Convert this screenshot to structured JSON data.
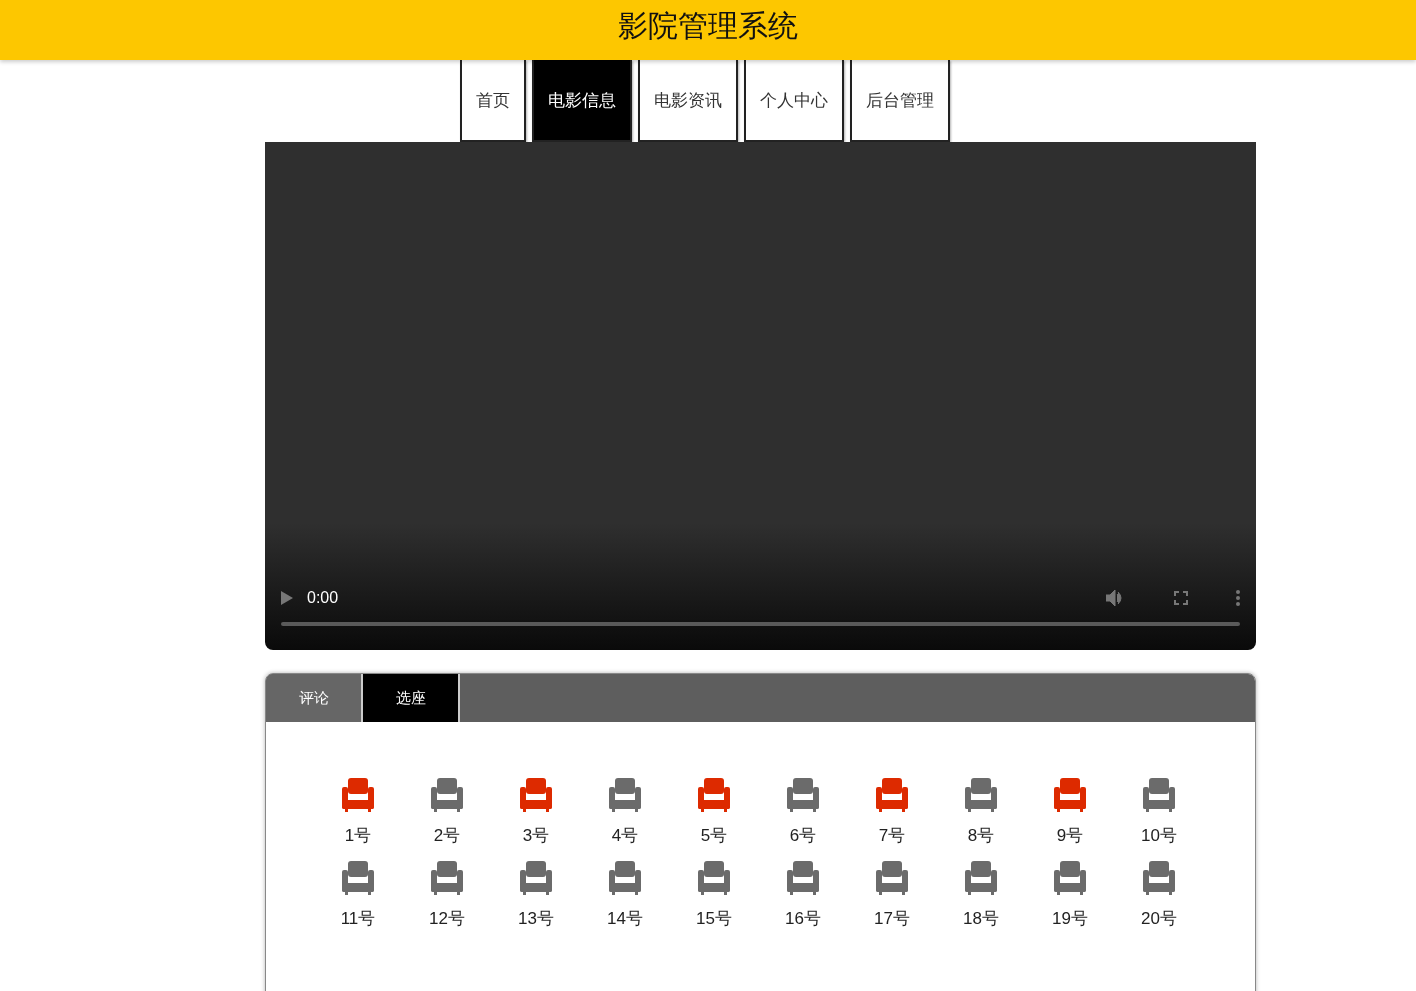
{
  "header": {
    "title": "影院管理系统"
  },
  "nav": [
    {
      "label": "首页",
      "selected": false
    },
    {
      "label": "电影信息",
      "selected": true
    },
    {
      "label": "电影资讯",
      "selected": false
    },
    {
      "label": "个人中心",
      "selected": false
    },
    {
      "label": "后台管理",
      "selected": false
    }
  ],
  "video": {
    "time": "0:00"
  },
  "panel": {
    "tabs": [
      {
        "label": "评论",
        "selected": false
      },
      {
        "label": "选座",
        "selected": true
      }
    ],
    "seats": [
      {
        "label": "1号",
        "taken": true
      },
      {
        "label": "2号",
        "taken": false
      },
      {
        "label": "3号",
        "taken": true
      },
      {
        "label": "4号",
        "taken": false
      },
      {
        "label": "5号",
        "taken": true
      },
      {
        "label": "6号",
        "taken": false
      },
      {
        "label": "7号",
        "taken": true
      },
      {
        "label": "8号",
        "taken": false
      },
      {
        "label": "9号",
        "taken": true
      },
      {
        "label": "10号",
        "taken": false
      },
      {
        "label": "11号",
        "taken": false
      },
      {
        "label": "12号",
        "taken": false
      },
      {
        "label": "13号",
        "taken": false
      },
      {
        "label": "14号",
        "taken": false
      },
      {
        "label": "15号",
        "taken": false
      },
      {
        "label": "16号",
        "taken": false
      },
      {
        "label": "17号",
        "taken": false
      },
      {
        "label": "18号",
        "taken": false
      },
      {
        "label": "19号",
        "taken": false
      },
      {
        "label": "20号",
        "taken": false
      }
    ]
  }
}
